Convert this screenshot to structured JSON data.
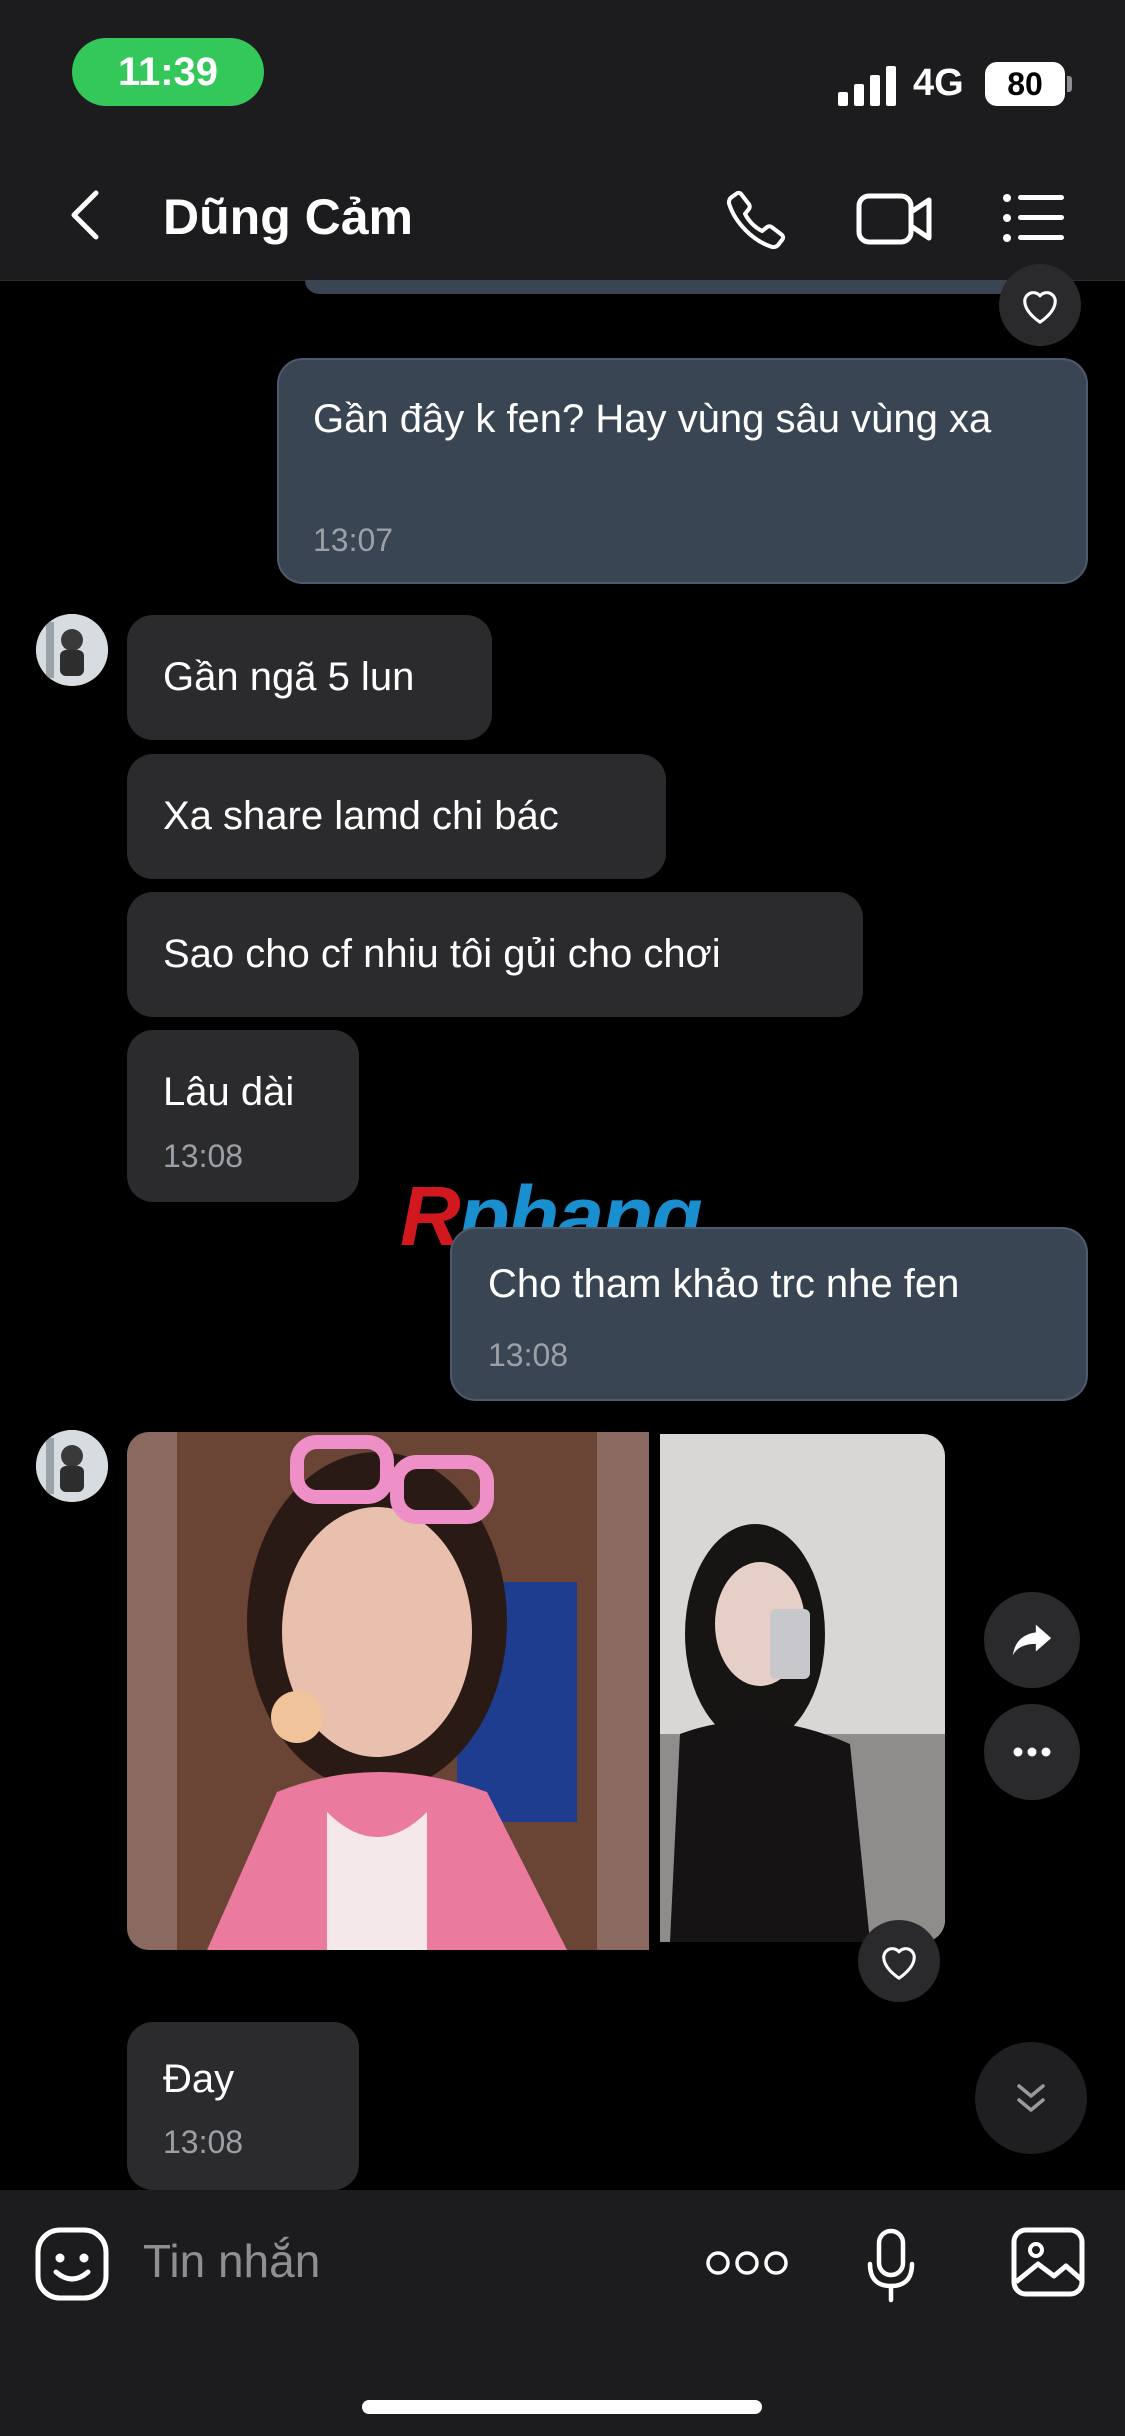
{
  "status_bar": {
    "time": "11:39",
    "network": "4G",
    "battery": "80"
  },
  "header": {
    "title": "Dũng Cảm",
    "icons": {
      "back": "chevron-left-icon",
      "call": "phone-icon",
      "video": "video-camera-icon",
      "menu": "list-menu-icon"
    }
  },
  "messages": [
    {
      "side": "out",
      "text": "Gần đây k fen? Hay vùng sâu vùng xa",
      "time": "13:07"
    },
    {
      "side": "in",
      "text": "Gần ngã 5 lun"
    },
    {
      "side": "in",
      "text": "Xa share lamd chi bác"
    },
    {
      "side": "in",
      "text": "Sao cho cf nhiu tôi gủi cho chơi"
    },
    {
      "side": "in",
      "text": "Lâu dài",
      "time": "13:08"
    },
    {
      "side": "out",
      "text": "Cho tham khảo trc nhe fen",
      "time": "13:08"
    },
    {
      "side": "in",
      "type": "photos",
      "count": 2
    },
    {
      "side": "in",
      "text": "Đay",
      "time": "13:08"
    }
  ],
  "watermark": {
    "text_r": "R",
    "text_rest": "phang"
  },
  "composer": {
    "placeholder": "Tin nhắn"
  },
  "colors": {
    "outgoing_bubble": "#3a4554",
    "incoming_bubble": "#2b2b2d",
    "status_pill": "#34c759",
    "watermark_red": "#d0181e",
    "watermark_blue": "#1a8fd0"
  }
}
